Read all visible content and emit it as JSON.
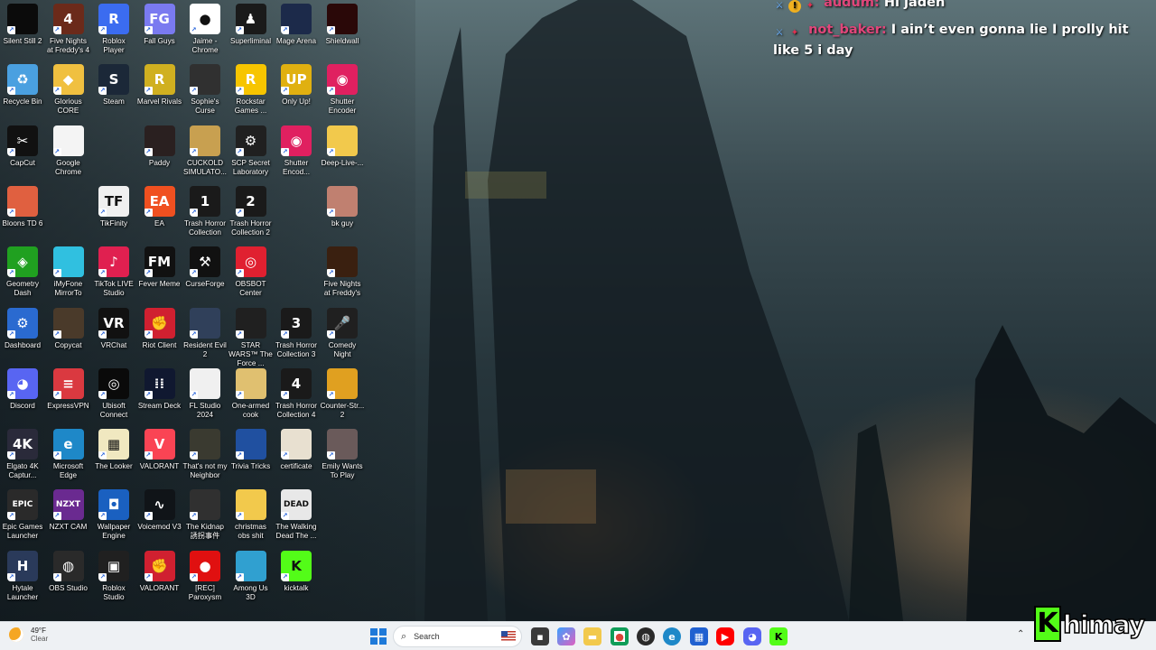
{
  "desktop": {
    "icons": [
      {
        "label": "Silent Still 2",
        "color": "#0b0b0b",
        "glyph": ""
      },
      {
        "label": "Five Nights at Freddy's 4",
        "color": "#6b2a1a",
        "glyph": "4"
      },
      {
        "label": "Roblox Player",
        "color": "#3b6cf0",
        "glyph": "R"
      },
      {
        "label": "Fall Guys",
        "color": "#7a7af0",
        "glyph": "FG"
      },
      {
        "label": "Jaime - Chrome",
        "color": "#ffffff",
        "glyph": "●"
      },
      {
        "label": "Superliminal",
        "color": "#1a1a1a",
        "glyph": "♟"
      },
      {
        "label": "Mage Arena",
        "color": "#1c2a4a",
        "glyph": ""
      },
      {
        "label": "Shieldwall",
        "color": "#2a0808",
        "glyph": ""
      },
      {
        "label": "Recycle Bin",
        "color": "#4aa0e0",
        "glyph": "♻"
      },
      {
        "label": "Glorious CORE",
        "color": "#f0c040",
        "glyph": "◆"
      },
      {
        "label": "Steam",
        "color": "#1b2838",
        "glyph": "S"
      },
      {
        "label": "Marvel Rivals",
        "color": "#d0b020",
        "glyph": "R"
      },
      {
        "label": "Sophie's Curse",
        "color": "#303030",
        "glyph": ""
      },
      {
        "label": "Rockstar Games ...",
        "color": "#f7c500",
        "glyph": "R"
      },
      {
        "label": "Only Up!",
        "color": "#e0b010",
        "glyph": "UP"
      },
      {
        "label": "Shutter Encoder",
        "color": "#e02060",
        "glyph": "◉"
      },
      {
        "label": "CapCut",
        "color": "#111111",
        "glyph": "✂"
      },
      {
        "label": "Google Chrome",
        "color": "#f4f4f4",
        "glyph": ""
      },
      {
        "label": "Paddy",
        "color": "#2a2020",
        "glyph": ""
      },
      {
        "label": "CUCKOLD SIMULATO...",
        "color": "#c8a050",
        "glyph": ""
      },
      {
        "label": "SCP Secret Laboratory",
        "color": "#202020",
        "glyph": "⚙"
      },
      {
        "label": "Shutter Encod...",
        "color": "#e02060",
        "glyph": "◉"
      },
      {
        "label": "Deep-Live-...",
        "color": "#f2c94c",
        "glyph": ""
      },
      {
        "label": "Bloons TD 6",
        "color": "#e06040",
        "glyph": ""
      },
      {
        "label": "TikFinity",
        "color": "#f0f0f0",
        "glyph": "TF"
      },
      {
        "label": "EA",
        "color": "#f05020",
        "glyph": "EA"
      },
      {
        "label": "Trash Horror Collection",
        "color": "#1a1a1a",
        "glyph": "1"
      },
      {
        "label": "Trash Horror Collection 2",
        "color": "#1a1a1a",
        "glyph": "2"
      },
      {
        "label": "bk guy",
        "color": "#c08070",
        "glyph": ""
      },
      {
        "label": "Geometry Dash",
        "color": "#20a020",
        "glyph": "◈"
      },
      {
        "label": "iMyFone MirrorTo",
        "color": "#30c0e0",
        "glyph": ""
      },
      {
        "label": "TikTok LIVE Studio",
        "color": "#e02050",
        "glyph": "♪"
      },
      {
        "label": "Fever Meme",
        "color": "#111111",
        "glyph": "FM"
      },
      {
        "label": "CurseForge",
        "color": "#111111",
        "glyph": "⚒"
      },
      {
        "label": "OBSBOT Center",
        "color": "#e02030",
        "glyph": "◎"
      },
      {
        "label": "Five Nights at Freddy's",
        "color": "#3a2010",
        "glyph": ""
      },
      {
        "label": "Dashboard",
        "color": "#2a6ad0",
        "glyph": "⚙"
      },
      {
        "label": "Copycat",
        "color": "#4a3a2a",
        "glyph": ""
      },
      {
        "label": "VRChat",
        "color": "#111111",
        "glyph": "VR"
      },
      {
        "label": "Riot Client",
        "color": "#d02030",
        "glyph": "✊"
      },
      {
        "label": "Resident Evil 2",
        "color": "#30405a",
        "glyph": ""
      },
      {
        "label": "STAR WARS™ The Force ...",
        "color": "#202020",
        "glyph": ""
      },
      {
        "label": "Trash Horror Collection 3",
        "color": "#1a1a1a",
        "glyph": "3"
      },
      {
        "label": "Comedy Night",
        "color": "#202020",
        "glyph": "🎤"
      },
      {
        "label": "Discord",
        "color": "#5865f2",
        "glyph": "◕"
      },
      {
        "label": "ExpressVPN",
        "color": "#da3940",
        "glyph": "≡"
      },
      {
        "label": "Ubisoft Connect",
        "color": "#0a0a0a",
        "glyph": "◎"
      },
      {
        "label": "Stream Deck",
        "color": "#101830",
        "glyph": "⁞⁞"
      },
      {
        "label": "FL Studio 2024",
        "color": "#f0f0f0",
        "glyph": ""
      },
      {
        "label": "One-armed cook",
        "color": "#e0c070",
        "glyph": ""
      },
      {
        "label": "Trash Horror Collection 4",
        "color": "#1a1a1a",
        "glyph": "4"
      },
      {
        "label": "Counter-Str... 2",
        "color": "#e0a020",
        "glyph": ""
      },
      {
        "label": "Elgato 4K Captur...",
        "color": "#2a2a3a",
        "glyph": "4K"
      },
      {
        "label": "Microsoft Edge",
        "color": "#1e88c8",
        "glyph": "e"
      },
      {
        "label": "The Looker",
        "color": "#f0e8c0",
        "glyph": "▦"
      },
      {
        "label": "VALORANT",
        "color": "#fa4454",
        "glyph": "V"
      },
      {
        "label": "That's not my Neighbor",
        "color": "#3a3a30",
        "glyph": ""
      },
      {
        "label": "Trivia Tricks",
        "color": "#2050a0",
        "glyph": ""
      },
      {
        "label": "certificate",
        "color": "#e8e0d0",
        "glyph": ""
      },
      {
        "label": "Emily Wants To Play",
        "color": "#6a5a5a",
        "glyph": ""
      },
      {
        "label": "Epic Games Launcher",
        "color": "#2a2a2a",
        "glyph": "EPIC"
      },
      {
        "label": "NZXT CAM",
        "color": "#6a2a90",
        "glyph": "NZXT"
      },
      {
        "label": "Wallpaper Engine",
        "color": "#1a60c0",
        "glyph": "◘"
      },
      {
        "label": "Voicemod V3",
        "color": "#101418",
        "glyph": "∿"
      },
      {
        "label": "The Kidnap 誘拐事件",
        "color": "#303030",
        "glyph": ""
      },
      {
        "label": "christmas obs shit",
        "color": "#f2c94c",
        "glyph": ""
      },
      {
        "label": "The Walking Dead The ...",
        "color": "#e8e8e8",
        "glyph": "DEAD"
      },
      {
        "label": "Hytale Launcher",
        "color": "#2a3a5a",
        "glyph": "H"
      },
      {
        "label": "OBS Studio",
        "color": "#2a2a2a",
        "glyph": "◍"
      },
      {
        "label": "Roblox Studio",
        "color": "#202020",
        "glyph": "▣"
      },
      {
        "label": "VALORANT",
        "color": "#d02030",
        "glyph": "✊"
      },
      {
        "label": "[REC] Paroxysm",
        "color": "#e01010",
        "glyph": "●"
      },
      {
        "label": "Among Us 3D",
        "color": "#30a0d0",
        "glyph": ""
      },
      {
        "label": "kicktalk",
        "color": "#53fc18",
        "glyph": "K"
      }
    ]
  },
  "chat": {
    "messages": [
      {
        "user": "audum:",
        "text": "Hi jaden"
      },
      {
        "user": "not_baker:",
        "text": "I ain’t even gonna lie I prolly hit like 5 i day"
      }
    ]
  },
  "taskbar": {
    "weather_temp": "49°F",
    "weather_desc": "Clear",
    "search_placeholder": "Search",
    "apps": [
      "file-manager",
      "copilot",
      "file-explorer",
      "chrome",
      "obs",
      "edge",
      "store",
      "youtube",
      "discord",
      "kick"
    ]
  },
  "overlay": {
    "brand_letter": "K",
    "brand_name": "himay"
  }
}
